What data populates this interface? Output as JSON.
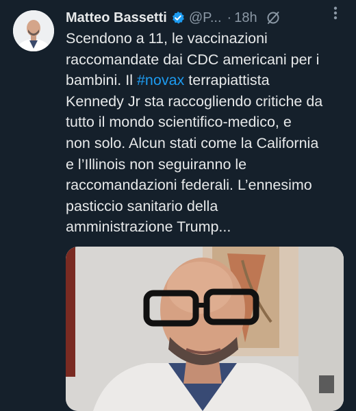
{
  "author": {
    "name": "Matteo Bassetti",
    "handle": "@P...",
    "separator": "·",
    "timestamp": "18h"
  },
  "tweet": {
    "lines": [
      "Scendono a 11, le vaccinazioni",
      "raccomandate dai CDC americani per i",
      "bambini. Il ",
      "Kennedy Jr sta raccogliendo critiche da",
      "tutto il mondo scientifico-medico, e",
      "non solo. Alcun stati come la California",
      "e l’Illinois non seguiranno le",
      "raccomandazioni federali. L’ennesimo",
      "pasticcio sanitario della",
      "amministrazione Trump..."
    ],
    "hashtag": "#novax",
    "after_hashtag": " terrapiattista"
  },
  "icons": {
    "verified": "verified-badge-icon",
    "grok": "grok-icon",
    "more": "more-options-icon"
  },
  "colors": {
    "background": "#15202b",
    "text": "#e7e9ea",
    "secondary": "#8b98a5",
    "link": "#1d9bf0"
  }
}
